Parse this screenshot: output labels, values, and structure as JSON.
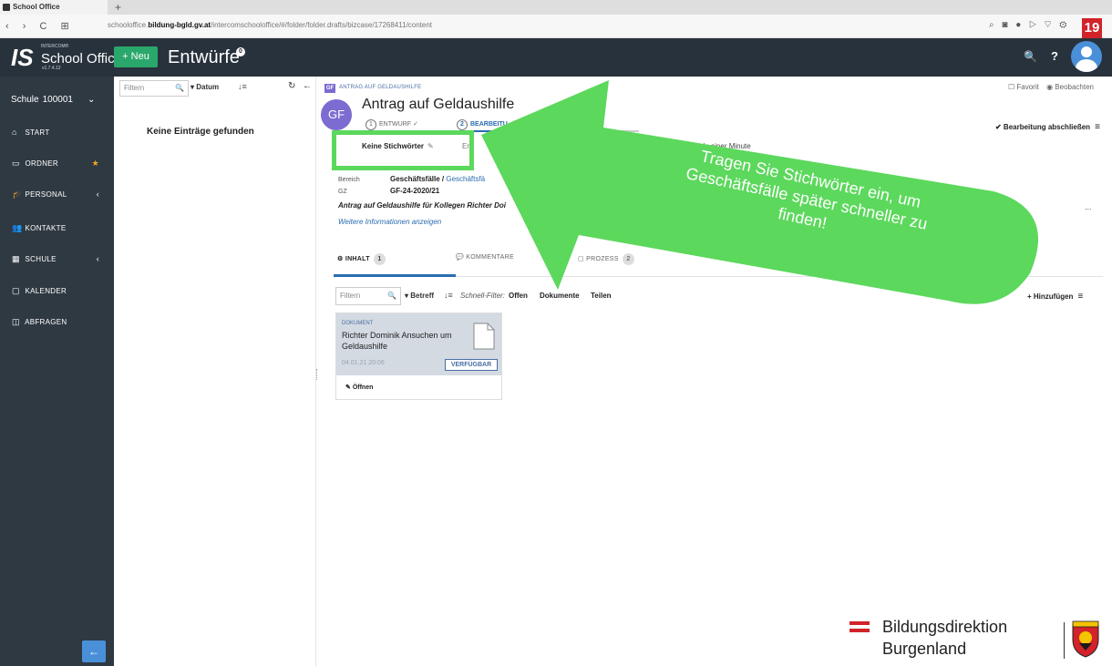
{
  "browser": {
    "tab_title": "School Office",
    "new_tab": "+",
    "nav_icons": "‹ › C ⊞",
    "url_prefix": "schooloffice.",
    "url_domain": "bildung-bgld.gv.at",
    "url_path": "/intercomschooloffice/#/folder/folder.drafts/bizcase/17268411/content",
    "ext_icons": "⌕ ◙ ● ▷ ♡ ⚙",
    "badge": "19"
  },
  "app": {
    "logo_mark": "IS",
    "logo_small": "INTERCOM®",
    "logo_name": "School Office",
    "version": "v1.7.4.12",
    "new_button": "+ Neu",
    "title": "Entwürfe",
    "title_badge": "0",
    "search_icon": "🔍",
    "help_label": "?"
  },
  "sidebar": {
    "school_label": "Schule",
    "school_number": "100001",
    "school_chevron": "⌄",
    "items": [
      {
        "label": "Start",
        "icon": "⌂",
        "tail": ""
      },
      {
        "label": "Ordner",
        "icon": "▭",
        "tail": "★"
      },
      {
        "label": "Personal",
        "icon": "🎓",
        "tail": "‹"
      },
      {
        "label": "Kontakte",
        "icon": "👥",
        "tail": ""
      },
      {
        "label": "Schule",
        "icon": "▦",
        "tail": "‹"
      },
      {
        "label": "Kalender",
        "icon": "▢",
        "tail": ""
      },
      {
        "label": "Abfragen",
        "icon": "◫",
        "tail": ""
      }
    ],
    "collapse_icon": "←"
  },
  "list": {
    "filter_placeholder": "Filtern",
    "search_icon": "🔍",
    "sort_label": "▾ Datum",
    "sort_dir_icon": "↓≡",
    "refresh_icon": "↻",
    "back_icon": "←",
    "empty_message": "Keine Einträge gefunden"
  },
  "case": {
    "tag": "GF",
    "breadcrumb": "ANTRAG AUF GELDAUSHILFE",
    "favorite": "☐ Favorit",
    "watch": "◉ Beobachten",
    "avatar": "GF",
    "title": "Antrag auf Geldaushilfe",
    "steps": [
      {
        "num": "1",
        "label": "ENTWURF ✓"
      },
      {
        "num": "2",
        "label": "BEARBEITU"
      },
      {
        "num": "",
        "label": "EGT"
      }
    ],
    "finish_label": "✔ Bearbeitung abschließen",
    "menu_icon": "≡",
    "keywords": "Keine Stichwörter",
    "keywords_edit": "✎",
    "keywords_extra": "Er",
    "time_info": "weniger als einer Minute",
    "meta": [
      {
        "label": "Bereich",
        "value": "Geschäftsfälle / ",
        "link": "Geschäftsfä"
      },
      {
        "label": "GZ",
        "value": "GF-24-2020/21",
        "link": ""
      }
    ],
    "description": "Antrag auf Geldaushilfe für Kollegen Richter Doi",
    "more_info": "Weitere Informationen anzeigen",
    "dots": "..."
  },
  "tabs": [
    {
      "label": "Inhalt",
      "icon": "⚙",
      "count": "1"
    },
    {
      "label": "Kommentare",
      "icon": "💬",
      "count": ""
    },
    {
      "label": "Prozess",
      "icon": "▢",
      "count": "2"
    }
  ],
  "content_filter": {
    "placeholder": "Filtern",
    "sort_label": "▾ Betreff",
    "sort_dir_icon": "↓≡",
    "quick_label": "Schnell-Filter:",
    "quick_links": [
      "Offen",
      "Dokumente",
      "Teilen"
    ],
    "add_label": "+ Hinzufügen",
    "menu_icon": "≡"
  },
  "document": {
    "type": "DOKUMENT",
    "title": "Richter Dominik Ansuchen um Geldaushilfe",
    "date": "04.01.21 20:06",
    "status": "VERFÜGBAR",
    "open_label": "Öffnen",
    "open_icon": "✎"
  },
  "callout": {
    "text": "Tragen Sie Stichwörter ein, um Geschäftsfälle später schneller zu finden!",
    "color": "#5cd85c"
  },
  "branding": {
    "name": "Bildungsdirektion",
    "region": "Burgenland"
  }
}
